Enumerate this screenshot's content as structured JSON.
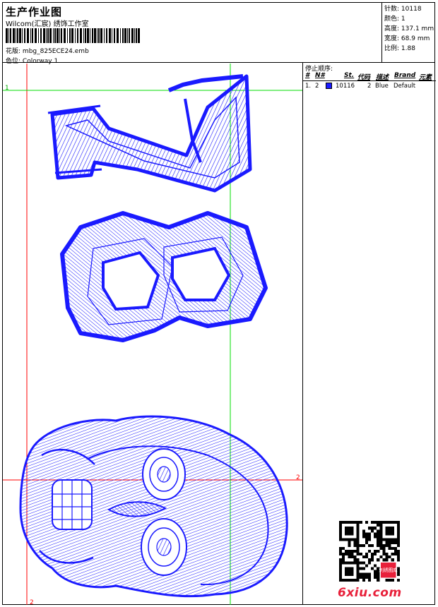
{
  "header": {
    "title": "生产作业图",
    "studio": "Wilcom(汇宸) 绣饰工作室",
    "file_label": "花版:",
    "file_name": "mbg_825ECE24.emb",
    "colorway_label": "色位:",
    "colorway": "Colorway 1"
  },
  "stats": [
    {
      "label": "针数:",
      "value": "10118"
    },
    {
      "label": "颜色:",
      "value": "1"
    },
    {
      "label": "高度:",
      "value": "137.1 mm"
    },
    {
      "label": "宽度:",
      "value": "68.9 mm"
    },
    {
      "label": "比例:",
      "value": "1.88"
    }
  ],
  "stop_panel": {
    "heading": "停止顺序:",
    "columns": [
      "#",
      "N#",
      "St.",
      "代码",
      "描述",
      "Brand",
      "元素"
    ],
    "rows": [
      {
        "num": "1.",
        "needle": "2",
        "stitches": "10116",
        "code": "2",
        "desc": "Blue",
        "brand": "Default",
        "elements": ""
      }
    ]
  },
  "guides": {
    "mark_1": "1",
    "mark_2_right": "2",
    "mark_2_bottom": "2"
  },
  "colors": {
    "thread": "#1a1aff",
    "guide_red": "#ff0000",
    "guide_green": "#00dd00",
    "logo": "#e8203a"
  },
  "watermark": {
    "text": "6xiu.com",
    "qr_seal": "刺绣图库"
  }
}
